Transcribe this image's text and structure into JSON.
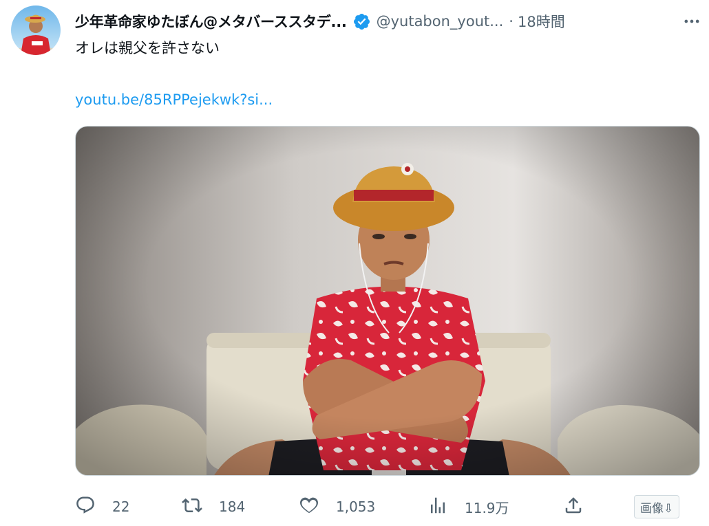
{
  "author": {
    "display_name": "少年革命家ゆたぼん@メタバーススタデ...",
    "handle": "@yutabon_yout...",
    "timestamp_separator": "·",
    "timestamp": "18時間"
  },
  "tweet": {
    "text": "オレは親父を許さない",
    "link": "youtu.be/85RPPejekwk?si..."
  },
  "actions": {
    "replies": "22",
    "retweets": "184",
    "likes": "1,053",
    "views": "11.9万",
    "image_button": "画像⇩"
  },
  "icons": {
    "more": "more-icon",
    "verified": "verified-badge-icon",
    "reply": "reply-icon",
    "retweet": "retweet-icon",
    "like": "heart-icon",
    "views": "views-chart-icon",
    "share": "share-icon"
  },
  "colors": {
    "link": "#1d9bf0",
    "secondary_text": "#536471",
    "verified_badge": "#1d9bf0",
    "shirt": "#d8263a",
    "hat": "#c9872a"
  }
}
